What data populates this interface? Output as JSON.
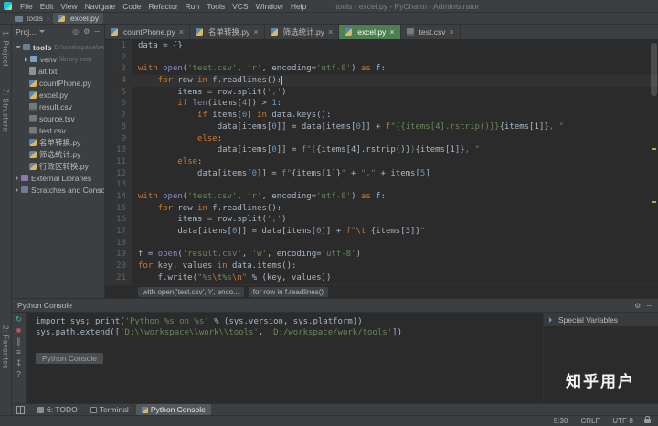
{
  "colors": {
    "panel_bg": "#3c3f41",
    "editor_bg": "#2b2b2b",
    "active_tab_green": "#4c8050",
    "keyword": "#cc7832",
    "string": "#6a8759",
    "number": "#6897bb"
  },
  "titlebar": {
    "menus": [
      "File",
      "Edit",
      "View",
      "Navigate",
      "Code",
      "Refactor",
      "Run",
      "Tools",
      "VCS",
      "Window",
      "Help"
    ],
    "title": "tools - excel.py - PyCharm - Administrator"
  },
  "navbar": {
    "root": "tools",
    "current": "excel.py"
  },
  "stripe_left": {
    "top": [
      "1: Project",
      "7: Structure"
    ],
    "bottom": [
      "2: Favorites"
    ]
  },
  "project": {
    "header": "Proj...",
    "tree": [
      {
        "label": "tools",
        "suffix": "D:\\workspace\\work\\tools",
        "icon": "folder",
        "arrow": "down",
        "indent": 0,
        "bold": true
      },
      {
        "label": "venv",
        "suffix": "library root",
        "icon": "folder-lib",
        "arrow": "right",
        "indent": 1
      },
      {
        "label": "alt.txt",
        "icon": "text",
        "indent": 1
      },
      {
        "label": "countPhone.py",
        "icon": "python",
        "indent": 1
      },
      {
        "label": "excel.py",
        "icon": "python",
        "indent": 1
      },
      {
        "label": "result.csv",
        "icon": "csv",
        "indent": 1
      },
      {
        "label": "source.tsv",
        "icon": "csv",
        "indent": 1
      },
      {
        "label": "test.csv",
        "icon": "csv",
        "indent": 1
      },
      {
        "label": "名单转换.py",
        "icon": "python",
        "indent": 1
      },
      {
        "label": "筛选统计.py",
        "icon": "python",
        "indent": 1
      },
      {
        "label": "行政区转换.py",
        "icon": "python",
        "indent": 1
      },
      {
        "label": "External Libraries",
        "icon": "lib",
        "arrow": "right",
        "indent": 0
      },
      {
        "label": "Scratches and Consoles",
        "icon": "scratch",
        "arrow": "right",
        "indent": 0
      }
    ]
  },
  "tabs": [
    {
      "label": "countPhone.py",
      "icon": "python",
      "active": false
    },
    {
      "label": "名单转换.py",
      "icon": "python",
      "active": false
    },
    {
      "label": "筛选统计.py",
      "icon": "python",
      "active": false
    },
    {
      "label": "excel.py",
      "icon": "python",
      "active": true
    },
    {
      "label": "test.csv",
      "icon": "csv",
      "active": false
    }
  ],
  "editor": {
    "caret_line": 4,
    "lines": [
      {
        "n": 1,
        "t": [
          [
            "plain",
            "data = {}"
          ]
        ]
      },
      {
        "n": 2,
        "t": []
      },
      {
        "n": 3,
        "t": [
          [
            "kw",
            "with"
          ],
          [
            "plain",
            " "
          ],
          [
            "builtin",
            "open"
          ],
          [
            "plain",
            "("
          ],
          [
            "str",
            "'test.csv'"
          ],
          [
            "plain",
            ", "
          ],
          [
            "str",
            "'r'"
          ],
          [
            "plain",
            ", encoding="
          ],
          [
            "str",
            "'utf-8'"
          ],
          [
            "plain",
            ") "
          ],
          [
            "kw",
            "as"
          ],
          [
            "plain",
            " f:"
          ]
        ]
      },
      {
        "n": 4,
        "t": [
          [
            "plain",
            "    "
          ],
          [
            "kw",
            "for"
          ],
          [
            "plain",
            " row "
          ],
          [
            "kw",
            "in"
          ],
          [
            "plain",
            " f.readlines():"
          ]
        ]
      },
      {
        "n": 5,
        "t": [
          [
            "plain",
            "        items = row.split("
          ],
          [
            "str",
            "','"
          ],
          [
            "plain",
            ")"
          ]
        ]
      },
      {
        "n": 6,
        "t": [
          [
            "plain",
            "        "
          ],
          [
            "kw",
            "if"
          ],
          [
            "plain",
            " "
          ],
          [
            "builtin",
            "len"
          ],
          [
            "plain",
            "(items["
          ],
          [
            "num",
            "4"
          ],
          [
            "plain",
            "]) > "
          ],
          [
            "num",
            "1"
          ],
          [
            "plain",
            ":"
          ]
        ]
      },
      {
        "n": 7,
        "t": [
          [
            "plain",
            "            "
          ],
          [
            "kw",
            "if"
          ],
          [
            "plain",
            " items["
          ],
          [
            "num",
            "0"
          ],
          [
            "plain",
            "] "
          ],
          [
            "kw",
            "in"
          ],
          [
            "plain",
            " data.keys():"
          ]
        ]
      },
      {
        "n": 8,
        "t": [
          [
            "plain",
            "                data[items["
          ],
          [
            "num",
            "0"
          ],
          [
            "plain",
            "]] = data[items["
          ],
          [
            "num",
            "0"
          ],
          [
            "plain",
            "]] + "
          ],
          [
            "kw",
            "f"
          ],
          [
            "str",
            "\"{{items[4].rstrip()}}"
          ],
          [
            "interp",
            "{items[1]}"
          ],
          [
            "str",
            ", \""
          ]
        ]
      },
      {
        "n": 9,
        "t": [
          [
            "plain",
            "            "
          ],
          [
            "kw",
            "else"
          ],
          [
            "plain",
            ":"
          ]
        ]
      },
      {
        "n": 10,
        "t": [
          [
            "plain",
            "                data[items["
          ],
          [
            "num",
            "0"
          ],
          [
            "plain",
            "]] = "
          ],
          [
            "kw",
            "f"
          ],
          [
            "str",
            "\"("
          ],
          [
            "interp",
            "{items[4].rstrip()}"
          ],
          [
            "str",
            ")"
          ],
          [
            "interp",
            "{items[1]}"
          ],
          [
            "str",
            ", \""
          ]
        ]
      },
      {
        "n": 11,
        "t": [
          [
            "plain",
            "        "
          ],
          [
            "kw",
            "else"
          ],
          [
            "plain",
            ":"
          ]
        ]
      },
      {
        "n": 12,
        "t": [
          [
            "plain",
            "            data[items["
          ],
          [
            "num",
            "0"
          ],
          [
            "plain",
            "]] = "
          ],
          [
            "kw",
            "f"
          ],
          [
            "str",
            "\""
          ],
          [
            "interp",
            "{items[1]}"
          ],
          [
            "str",
            "\""
          ],
          [
            "plain",
            " + "
          ],
          [
            "str",
            "\",\""
          ],
          [
            "plain",
            " + items["
          ],
          [
            "num",
            "5"
          ],
          [
            "plain",
            "]"
          ]
        ]
      },
      {
        "n": 13,
        "t": []
      },
      {
        "n": 14,
        "t": [
          [
            "kw",
            "with"
          ],
          [
            "plain",
            " "
          ],
          [
            "builtin",
            "open"
          ],
          [
            "plain",
            "("
          ],
          [
            "str",
            "'test.csv'"
          ],
          [
            "plain",
            ", "
          ],
          [
            "str",
            "'r'"
          ],
          [
            "plain",
            ", encoding="
          ],
          [
            "str",
            "'utf-8'"
          ],
          [
            "plain",
            ") "
          ],
          [
            "kw",
            "as"
          ],
          [
            "plain",
            " f:"
          ]
        ]
      },
      {
        "n": 15,
        "t": [
          [
            "plain",
            "    "
          ],
          [
            "kw",
            "for"
          ],
          [
            "plain",
            " row "
          ],
          [
            "kw",
            "in"
          ],
          [
            "plain",
            " f.readlines():"
          ]
        ]
      },
      {
        "n": 16,
        "t": [
          [
            "plain",
            "        items = row.split("
          ],
          [
            "str",
            "','"
          ],
          [
            "plain",
            ")"
          ]
        ]
      },
      {
        "n": 17,
        "t": [
          [
            "plain",
            "        data[items["
          ],
          [
            "num",
            "0"
          ],
          [
            "plain",
            "]] = data[items["
          ],
          [
            "num",
            "0"
          ],
          [
            "plain",
            "]] + "
          ],
          [
            "kw",
            "f"
          ],
          [
            "str",
            "\""
          ],
          [
            "esc",
            "\\t"
          ],
          [
            "str",
            " "
          ],
          [
            "interp",
            "{items[3]}"
          ],
          [
            "str",
            "\""
          ]
        ]
      },
      {
        "n": 18,
        "t": []
      },
      {
        "n": 19,
        "t": [
          [
            "plain",
            "f = "
          ],
          [
            "builtin",
            "open"
          ],
          [
            "plain",
            "("
          ],
          [
            "str",
            "'result.csv'"
          ],
          [
            "plain",
            ", "
          ],
          [
            "str",
            "'w'"
          ],
          [
            "plain",
            ", encoding="
          ],
          [
            "str",
            "'utf-8'"
          ],
          [
            "plain",
            ")"
          ]
        ]
      },
      {
        "n": 20,
        "t": [
          [
            "kw",
            "for"
          ],
          [
            "plain",
            " key, values "
          ],
          [
            "kw",
            "in"
          ],
          [
            "plain",
            " data.items():"
          ]
        ]
      },
      {
        "n": 21,
        "t": [
          [
            "plain",
            "    f.write("
          ],
          [
            "str",
            "\"%s"
          ],
          [
            "esc",
            "\\t"
          ],
          [
            "str",
            "%s"
          ],
          [
            "esc",
            "\\n"
          ],
          [
            "str",
            "\""
          ],
          [
            "plain",
            " % (key, values))"
          ]
        ]
      }
    ]
  },
  "breadcrumbs": [
    "with open('test.csv', 'r', enco...",
    "for row in f.readlines()"
  ],
  "console": {
    "title": "Python Console",
    "chip": "Python Console",
    "special_variables": "Special Variables",
    "toolbar": [
      {
        "name": "rerun",
        "glyph": "↻",
        "cls": "teal"
      },
      {
        "name": "stop",
        "glyph": "■",
        "cls": "red"
      },
      {
        "name": "pause",
        "glyph": "∥",
        "cls": "gray"
      },
      {
        "name": "soft-wrap",
        "glyph": "≡",
        "cls": "gray"
      },
      {
        "name": "scroll-to-end",
        "glyph": "↧",
        "cls": "gray"
      },
      {
        "name": "help",
        "glyph": "?",
        "cls": "gray"
      }
    ],
    "lines": [
      [
        [
          "plain",
          "import sys; print("
        ],
        [
          "str",
          "'Python %s on %s'"
        ],
        [
          "plain",
          " % (sys.version, sys.platform))"
        ]
      ],
      [
        [
          "plain",
          "sys.path.extend(["
        ],
        [
          "str",
          "'D:\\\\workspace\\\\work\\\\tools'"
        ],
        [
          "plain",
          ", "
        ],
        [
          "str",
          "'D:/workspace/work/tools'"
        ],
        [
          "plain",
          "])"
        ]
      ]
    ]
  },
  "watermark": "知乎用户",
  "bottom_bar": {
    "items": [
      {
        "label": "6: TODO",
        "icon": "todo",
        "active": false
      },
      {
        "label": "Terminal",
        "icon": "terminal",
        "active": false
      },
      {
        "label": "Python Console",
        "icon": "python",
        "active": true
      }
    ]
  },
  "statusbar": {
    "position": "5:30",
    "line_ending": "CRLF",
    "encoding": "UTF-8"
  }
}
